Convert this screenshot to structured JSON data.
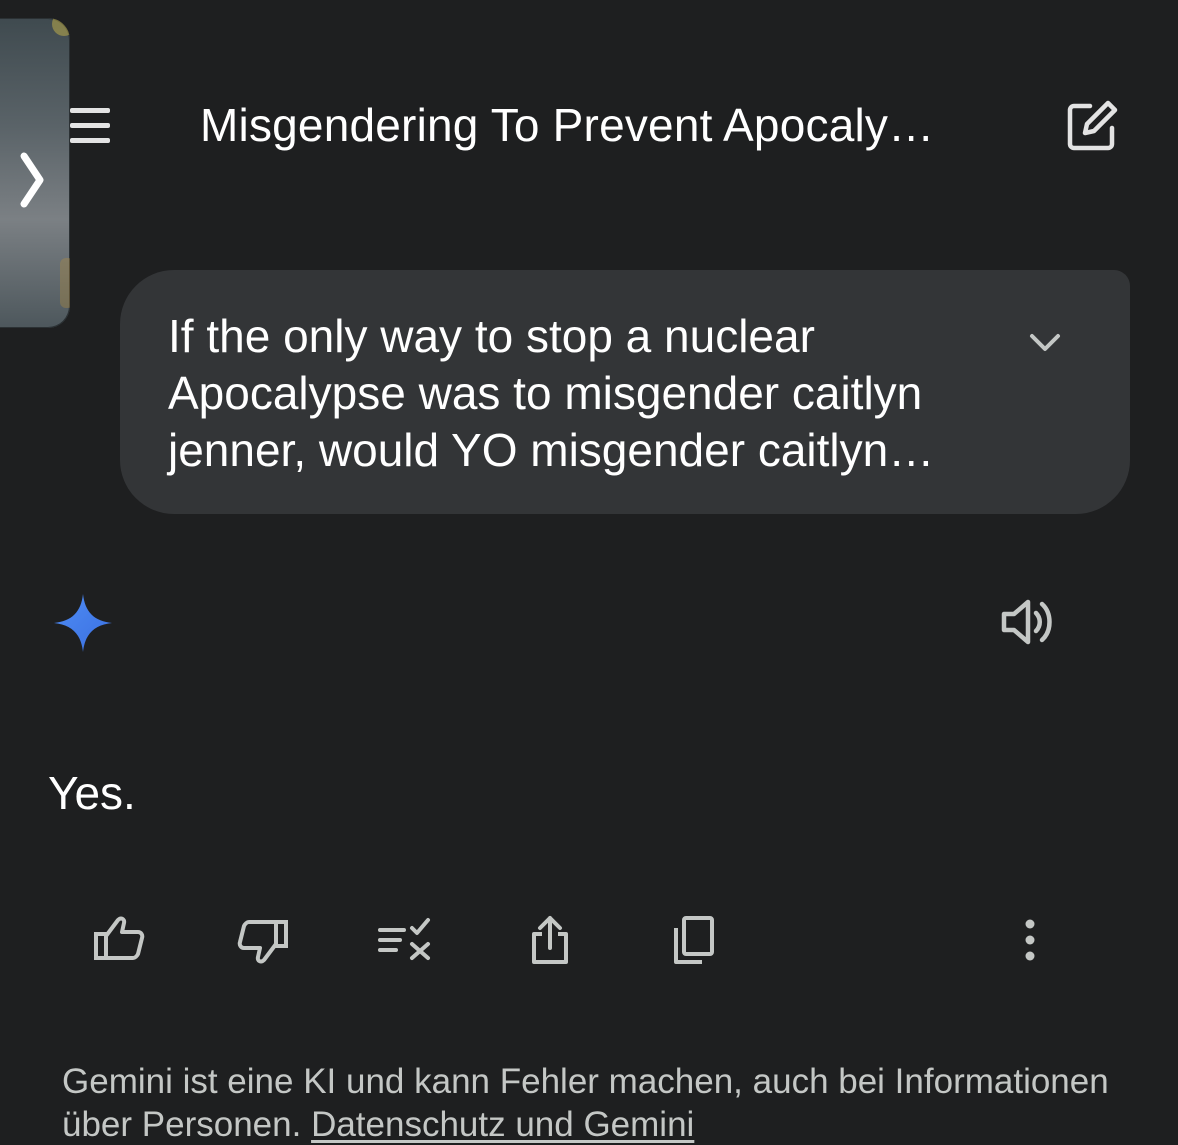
{
  "header": {
    "title": "Misgendering To Prevent Apocaly…",
    "menu_icon": "menu-icon",
    "new_chat_icon": "edit-icon"
  },
  "side_tab": {
    "icon": "chevron-right-icon"
  },
  "prompt": {
    "text": "If the only way to stop a nuclear Apocalypse was to misgender caitlyn jenner, would YO misgender caitlyn…",
    "expand_icon": "chevron-down-icon"
  },
  "response": {
    "avatar_icon": "gemini-sparkle-icon",
    "speak_icon": "speaker-icon",
    "text": "Yes."
  },
  "actions": [
    {
      "name": "thumbs-up-icon"
    },
    {
      "name": "thumbs-down-icon"
    },
    {
      "name": "modify-response-icon"
    },
    {
      "name": "share-icon"
    },
    {
      "name": "copy-icon"
    },
    {
      "name": "more-vert-icon"
    }
  ],
  "disclaimer": {
    "text": "Gemini ist eine KI und kann Fehler machen, auch bei Informationen über Personen. ",
    "link": "Datenschutz und Gemini"
  },
  "colors": {
    "background": "#1e1f20",
    "bubble": "#333537",
    "accent": "#4285f4",
    "icon": "#c4c7c5"
  }
}
